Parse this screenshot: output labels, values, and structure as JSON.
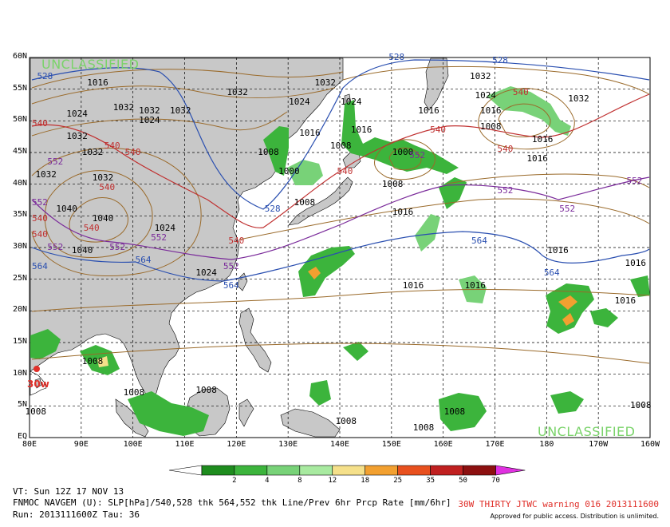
{
  "map": {
    "classification": "UNCLASSIFIED",
    "lat_labels": [
      "60N",
      "55N",
      "50N",
      "45N",
      "40N",
      "35N",
      "30N",
      "25N",
      "20N",
      "15N",
      "10N",
      "5N",
      "EQ"
    ],
    "lon_labels": [
      "80E",
      "90E",
      "100E",
      "110E",
      "120E",
      "130E",
      "140E",
      "150E",
      "160E",
      "170E",
      "180",
      "170W",
      "160W"
    ],
    "storm_label": "30w",
    "colors": {
      "land": "#c8c8c8",
      "sea": "#ffffff",
      "slp_contour": "#9a6a2a",
      "thk_528": "#2a4fb0",
      "thk_540": "#c03030",
      "thk_552": "#7a2a9a",
      "thk_564": "#2a4fb0",
      "precip_light": "#2e9c2e",
      "precip_med": "#7ad36a",
      "precip_heavy": "#f2a030",
      "storm": "#e0302a"
    },
    "slp_labels": [
      {
        "text": "1016",
        "lon": 93,
        "lat": 56
      },
      {
        "text": "1032",
        "lon": 98,
        "lat": 52
      },
      {
        "text": "1024",
        "lon": 89,
        "lat": 51
      },
      {
        "text": "1024",
        "lon": 103,
        "lat": 50
      },
      {
        "text": "1032",
        "lon": 103,
        "lat": 51.5
      },
      {
        "text": "1032",
        "lon": 89,
        "lat": 47.5
      },
      {
        "text": "1032",
        "lon": 92,
        "lat": 45
      },
      {
        "text": "1032",
        "lon": 83,
        "lat": 41.5
      },
      {
        "text": "1032",
        "lon": 94,
        "lat": 41
      },
      {
        "text": "1032",
        "lon": 109,
        "lat": 51.5
      },
      {
        "text": "1032",
        "lon": 120,
        "lat": 54.5
      },
      {
        "text": "1032",
        "lon": 137,
        "lat": 56
      },
      {
        "text": "1024",
        "lon": 132,
        "lat": 53
      },
      {
        "text": "1024",
        "lon": 142,
        "lat": 53
      },
      {
        "text": "1016",
        "lon": 134,
        "lat": 48
      },
      {
        "text": "1016",
        "lon": 144,
        "lat": 48.5
      },
      {
        "text": "1008",
        "lon": 126,
        "lat": 45
      },
      {
        "text": "1000",
        "lon": 130,
        "lat": 42
      },
      {
        "text": "1008",
        "lon": 140,
        "lat": 46
      },
      {
        "text": "1000",
        "lon": 152,
        "lat": 45
      },
      {
        "text": "1008",
        "lon": 150,
        "lat": 40
      },
      {
        "text": "1016",
        "lon": 157,
        "lat": 51.5
      },
      {
        "text": "1032",
        "lon": 167,
        "lat": 57
      },
      {
        "text": "1024",
        "lon": 168,
        "lat": 54
      },
      {
        "text": "1016",
        "lon": 169,
        "lat": 51.5
      },
      {
        "text": "1008",
        "lon": 169,
        "lat": 49
      },
      {
        "text": "1016",
        "lon": 179,
        "lat": 47
      },
      {
        "text": "1016",
        "lon": 178,
        "lat": 44
      },
      {
        "text": "1032",
        "lon": 186,
        "lat": 53.5
      },
      {
        "text": "1008",
        "lon": 133,
        "lat": 37
      },
      {
        "text": "1016",
        "lon": 152,
        "lat": 35.5
      },
      {
        "text": "1040",
        "lon": 87,
        "lat": 36
      },
      {
        "text": "1040",
        "lon": 94,
        "lat": 34.5
      },
      {
        "text": "1024",
        "lon": 106,
        "lat": 33
      },
      {
        "text": "1040",
        "lon": 90,
        "lat": 29.5
      },
      {
        "text": "1024",
        "lon": 114,
        "lat": 26
      },
      {
        "text": "1016",
        "lon": 154,
        "lat": 24
      },
      {
        "text": "1016",
        "lon": 166,
        "lat": 24
      },
      {
        "text": "1016",
        "lon": 182,
        "lat": 29.5
      },
      {
        "text": "1016",
        "lon": 197,
        "lat": 27.5
      },
      {
        "text": "1016",
        "lon": 195,
        "lat": 21.5
      },
      {
        "text": "1008",
        "lon": 92,
        "lat": 12
      },
      {
        "text": "1008",
        "lon": 81,
        "lat": 4
      },
      {
        "text": "1008",
        "lon": 100,
        "lat": 7
      },
      {
        "text": "1008",
        "lon": 114,
        "lat": 7.5
      },
      {
        "text": "1008",
        "lon": 141,
        "lat": 2.5
      },
      {
        "text": "1008",
        "lon": 156,
        "lat": 1.5
      },
      {
        "text": "1008",
        "lon": 162,
        "lat": 4
      },
      {
        "text": "1008",
        "lon": 198,
        "lat": 5
      }
    ],
    "thk_labels": [
      {
        "text": "528",
        "lon": 83,
        "lat": 57,
        "series": "thk_528"
      },
      {
        "text": "528",
        "lon": 151,
        "lat": 60,
        "series": "thk_528"
      },
      {
        "text": "528",
        "lon": 171,
        "lat": 59.5,
        "series": "thk_528"
      },
      {
        "text": "528",
        "lon": 127,
        "lat": 36,
        "series": "thk_528"
      },
      {
        "text": "540",
        "lon": 82,
        "lat": 49.5,
        "series": "thk_540"
      },
      {
        "text": "540",
        "lon": 96,
        "lat": 46,
        "series": "thk_540"
      },
      {
        "text": "540",
        "lon": 100,
        "lat": 45,
        "series": "thk_540"
      },
      {
        "text": "540",
        "lon": 95,
        "lat": 39.5,
        "series": "thk_540"
      },
      {
        "text": "540",
        "lon": 82,
        "lat": 34.5,
        "series": "thk_540"
      },
      {
        "text": "540",
        "lon": 82,
        "lat": 32,
        "series": "thk_540"
      },
      {
        "text": "540",
        "lon": 92,
        "lat": 33,
        "series": "thk_540"
      },
      {
        "text": "540",
        "lon": 120,
        "lat": 31,
        "series": "thk_540"
      },
      {
        "text": "540",
        "lon": 141,
        "lat": 42,
        "series": "thk_540"
      },
      {
        "text": "540",
        "lon": 159,
        "lat": 48.5,
        "series": "thk_540"
      },
      {
        "text": "540",
        "lon": 172,
        "lat": 45.5,
        "series": "thk_540"
      },
      {
        "text": "540",
        "lon": 175,
        "lat": 54.5,
        "series": "thk_540"
      },
      {
        "text": "552",
        "lon": 85,
        "lat": 43.5,
        "series": "thk_552"
      },
      {
        "text": "552",
        "lon": 82,
        "lat": 37,
        "series": "thk_552"
      },
      {
        "text": "552",
        "lon": 85,
        "lat": 30,
        "series": "thk_552"
      },
      {
        "text": "552",
        "lon": 97,
        "lat": 30,
        "series": "thk_552"
      },
      {
        "text": "552",
        "lon": 105,
        "lat": 31.5,
        "series": "thk_552"
      },
      {
        "text": "552",
        "lon": 119,
        "lat": 27,
        "series": "thk_552"
      },
      {
        "text": "552",
        "lon": 155,
        "lat": 44.5,
        "series": "thk_552"
      },
      {
        "text": "552",
        "lon": 172,
        "lat": 39,
        "series": "thk_552"
      },
      {
        "text": "552",
        "lon": 184,
        "lat": 36,
        "series": "thk_552"
      },
      {
        "text": "552",
        "lon": 197,
        "lat": 40.5,
        "series": "thk_552"
      },
      {
        "text": "564",
        "lon": 82,
        "lat": 27,
        "series": "thk_564"
      },
      {
        "text": "564",
        "lon": 102,
        "lat": 28,
        "series": "thk_564"
      },
      {
        "text": "564",
        "lon": 119,
        "lat": 24,
        "series": "thk_564"
      },
      {
        "text": "564",
        "lon": 167,
        "lat": 31,
        "series": "thk_564"
      },
      {
        "text": "564",
        "lon": 181,
        "lat": 26,
        "series": "thk_564"
      }
    ]
  },
  "colorbar": {
    "values": [
      "2",
      "4",
      "8",
      "12",
      "18",
      "25",
      "35",
      "50",
      "70"
    ],
    "colors": [
      "#1e8c1e",
      "#3cb43c",
      "#78d278",
      "#a8eaa0",
      "#f5e08a",
      "#f2a030",
      "#e8501e",
      "#c02020",
      "#8c1010",
      "#e030e0"
    ]
  },
  "footer": {
    "vt": "VT: Sun 12Z 17 NOV 13",
    "model": "FNMOC NAVGEM (U): SLP[hPa]/540,528 thk 564,552 thk Line/Prev 6hr Prcp Rate [mm/6hr]",
    "run": "Run: 2013111600Z  Tau: 36",
    "warning": "30W THIRTY JTWC warning 016 2013111600",
    "approved": "Approved for public access. Distribution is unlimited."
  }
}
